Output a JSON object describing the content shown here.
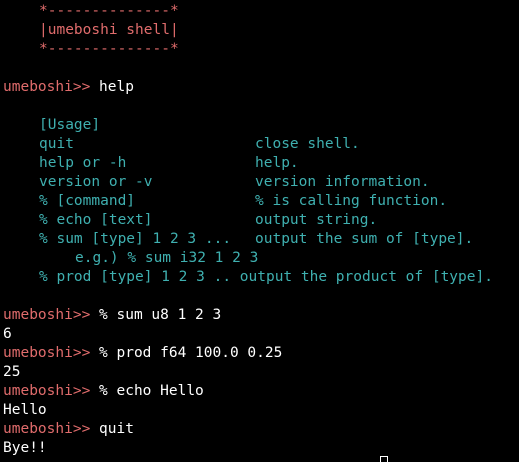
{
  "banner": {
    "border_top": "*--------------*",
    "title": "|umeboshi shell|",
    "border_bottom": "*--------------*"
  },
  "prompt": "umeboshi>> ",
  "session": {
    "cmd_help": "help",
    "usage_header": "[Usage]",
    "usage_rows": [
      {
        "cmd": "quit",
        "desc": "close shell."
      },
      {
        "cmd": "help or -h",
        "desc": "help."
      },
      {
        "cmd": "version or -v",
        "desc": "version information."
      },
      {
        "cmd": "% [command]",
        "desc": "% is calling function."
      },
      {
        "cmd": "% echo [text]",
        "desc": "output string."
      },
      {
        "cmd": "% sum [type] 1 2 3 ...",
        "desc": "output the sum of [type]."
      }
    ],
    "usage_example": "e.g.) % sum i32 1 2 3",
    "usage_prod": "% prod [type] 1 2 3 .. output the product of [type].",
    "cmd_sum": "% sum u8 1 2 3",
    "out_sum": "6",
    "cmd_prod": "% prod f64 100.0 0.25",
    "out_prod": "25",
    "cmd_echo": "% echo Hello",
    "out_echo": "Hello",
    "cmd_quit": "quit",
    "out_quit": "Bye!!"
  },
  "colors": {
    "background": "#000000",
    "prompt": "#e06c6c",
    "usage_text": "#3fb0b0",
    "output_text": "#ffffff"
  }
}
